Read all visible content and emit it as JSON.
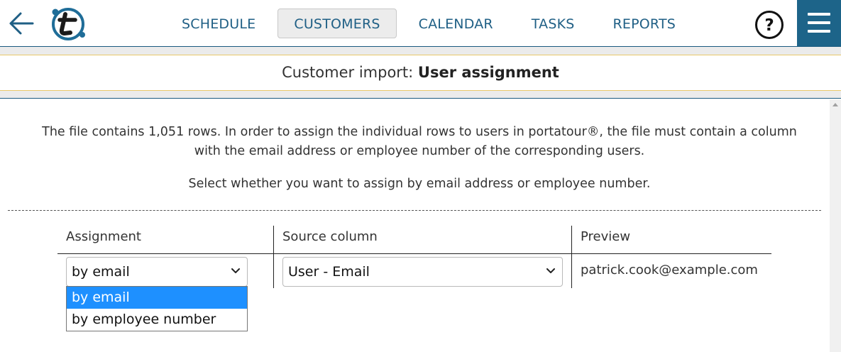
{
  "nav": {
    "items": [
      {
        "label": "SCHEDULE",
        "active": false
      },
      {
        "label": "CUSTOMERS",
        "active": true
      },
      {
        "label": "CALENDAR",
        "active": false
      },
      {
        "label": "TASKS",
        "active": false
      },
      {
        "label": "REPORTS",
        "active": false
      }
    ],
    "help_label": "?"
  },
  "page": {
    "title_prefix": "Customer import: ",
    "title_bold": "User assignment"
  },
  "content": {
    "description_line1": "The file contains 1,051 rows. In order to assign the individual rows to users in portatour®, the file must contain a column",
    "description_line2": "with the email address or employee number of the corresponding users.",
    "instruction": "Select whether you want to assign by email address or employee number."
  },
  "table": {
    "headers": {
      "assignment": "Assignment",
      "source_column": "Source column",
      "preview": "Preview"
    },
    "assignment_value": "by email",
    "source_column_value": "User - Email",
    "preview_value": "patrick.cook@example.com"
  },
  "dropdown": {
    "options": [
      {
        "label": "by email",
        "highlighted": true
      },
      {
        "label": "by employee number",
        "highlighted": false
      }
    ]
  },
  "colors": {
    "brand": "#1d6489",
    "nav_text": "#1f5f85",
    "accent_line": "#e8c86a",
    "dropdown_highlight": "#1e90ff"
  }
}
